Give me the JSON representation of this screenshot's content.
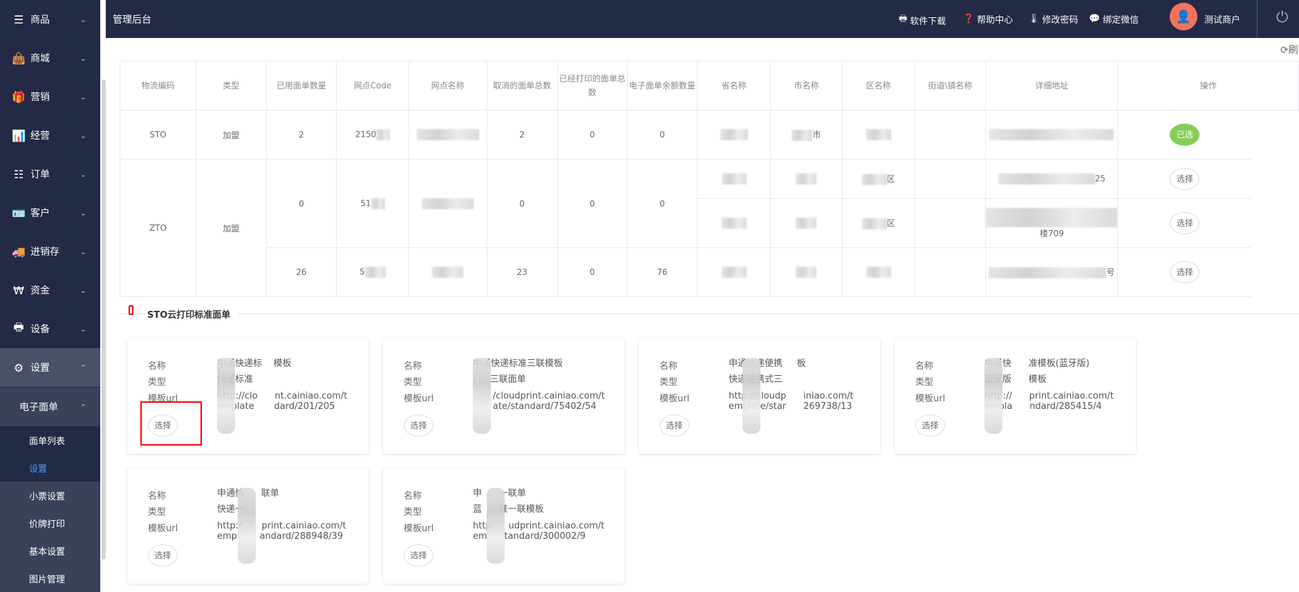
{
  "sidebar": {
    "items": [
      {
        "label": "商品",
        "icon": "list-icon",
        "g": "☰"
      },
      {
        "label": "商城",
        "icon": "bag-icon",
        "g": "👜"
      },
      {
        "label": "营销",
        "icon": "gift-icon",
        "g": "🎁"
      },
      {
        "label": "经营",
        "icon": "bar-chart-icon",
        "g": "📊"
      },
      {
        "label": "订单",
        "icon": "list-icon",
        "g": "☷"
      },
      {
        "label": "客户",
        "icon": "contact-card-icon",
        "g": "🪪"
      },
      {
        "label": "进销存",
        "icon": "truck-icon",
        "g": "🚚"
      },
      {
        "label": "资金",
        "icon": "won-icon",
        "g": "₩"
      },
      {
        "label": "设备",
        "icon": "printer-icon",
        "g": "🖶"
      },
      {
        "label": "设置",
        "icon": "gear-icon",
        "g": "⚙"
      }
    ],
    "group": "电子面单",
    "subs": [
      "面单列表",
      "设置",
      "小票设置",
      "价牌打印",
      "基本设置",
      "图片管理"
    ]
  },
  "header": {
    "title": "管理后台",
    "links": [
      "软件下载",
      "帮助中心",
      "修改密码",
      "绑定微信"
    ],
    "user": "测试商户"
  },
  "refresh": "刷",
  "table": {
    "headers": [
      "物流编码",
      "类型",
      "已用面单数量",
      "网点Code",
      "网点名称",
      "取消的面单总数",
      "已经打印的面单总数",
      "电子面单余额数量",
      "省名称",
      "市名称",
      "区名称",
      "街道\\镇名称",
      "详细地址",
      "操作"
    ],
    "sto": {
      "code": "STO",
      "type": "加盟",
      "used": "2",
      "site": "2150",
      "cancel": "2",
      "printed": "0",
      "balance": "0",
      "city": "市",
      "action": "已选"
    },
    "zto": {
      "code": "ZTO",
      "type": "加盟",
      "rows": [
        {
          "used": "0",
          "site": "51",
          "cancel": "0",
          "printed": "0",
          "balance": "0",
          "district": "区",
          "addr": "25",
          "action": "选择"
        },
        {
          "district": "区",
          "addr": "楼709",
          "action": "选择"
        },
        {
          "used": "26",
          "site": "5",
          "cancel": "23",
          "printed": "0",
          "balance": "76",
          "addr": "号",
          "action": "选择"
        }
      ]
    }
  },
  "section": {
    "title": "STO云打印标准面单"
  },
  "labels": {
    "name": "名称",
    "type": "类型",
    "url": "模板url",
    "select": "选择"
  },
  "cards": [
    {
      "name": "申通快递标    模板",
      "type": "快递标准",
      "u1": "http://clo      nt.cainiao.com/t",
      "u2": "emplate       dard/201/205"
    },
    {
      "name": "申通快递标准三联模板",
      "type": "      三联面单",
      "u1": "       /cloudprint.cainiao.com/t",
      "u2": "       ate/standard/75402/54"
    },
    {
      "name": "申通快递便携     板",
      "type": "快递便携式三",
      "u1": "http://cloudp      iniao.com/t",
      "u2": "emplate/star      269738/13"
    },
    {
      "name": "申通快      准模板(蓝牙版)",
      "type": "蓝牙版      模板",
      "u1": "http://      print.cainiao.com/t",
      "u2": "empla      ndard/285415/4"
    },
    {
      "name": "申通快      联单",
      "type": "快递一",
      "u1": "http:/       print.cainiao.com/t",
      "u2": "empl       andard/288948/39"
    },
    {
      "name": "申      一联单",
      "type": "蓝      准一联模板",
      "u1": "http      udprint.cainiao.com/t",
      "u2": "em      tandard/300002/9"
    }
  ]
}
